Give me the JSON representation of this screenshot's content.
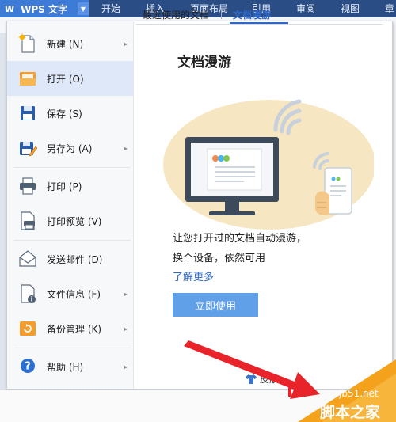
{
  "app": {
    "logo_text": "W",
    "title": "WPS 文字",
    "caret": "▼"
  },
  "ribbon_tabs": [
    "开始",
    "插入",
    "页面布局",
    "引用",
    "审阅",
    "视图",
    "章"
  ],
  "file_menu": {
    "items": [
      {
        "label": "新建 (N)",
        "icon": "new-document-icon",
        "arrow": "▸"
      },
      {
        "label": "打开 (O)",
        "icon": "open-folder-icon",
        "arrow": "",
        "active": true
      },
      {
        "label": "保存 (S)",
        "icon": "save-disk-icon",
        "arrow": ""
      },
      {
        "label": "另存为 (A)",
        "icon": "save-as-icon",
        "arrow": "▸"
      },
      {
        "label": "打印 (P)",
        "icon": "printer-icon",
        "arrow": ""
      },
      {
        "label": "打印预览 (V)",
        "icon": "print-preview-icon",
        "arrow": ""
      },
      {
        "label": "发送邮件 (D)",
        "icon": "mail-envelope-icon",
        "arrow": ""
      },
      {
        "label": "文件信息 (F)",
        "icon": "file-info-icon",
        "arrow": "▸"
      },
      {
        "label": "备份管理 (K)",
        "icon": "backup-icon",
        "arrow": "▸"
      },
      {
        "label": "帮助 (H)",
        "icon": "help-icon",
        "arrow": "▸"
      }
    ]
  },
  "right_panel": {
    "tabs": {
      "recent": "最近使用的文档",
      "roaming": "文档漫游"
    },
    "title": "文档漫游",
    "desc_line1": "让您打开过的文档自动漫游，",
    "desc_line2": "换个设备，依然可用",
    "learn_more": "了解更多",
    "use_now": "立即使用",
    "skin": "皮肤"
  },
  "watermark": {
    "url": "jb51.net",
    "name": "脚本之家"
  },
  "colors": {
    "ribbon": "#2a4d86",
    "app_button": "#3e7bd6",
    "accent_blue": "#2f67c8",
    "button_blue": "#5fa0e8",
    "active_item": "#dfe8f8",
    "illustration_bg": "#f6e7c2",
    "red_arrow": "#e8242a",
    "watermark_orange": "#f4a11c"
  }
}
